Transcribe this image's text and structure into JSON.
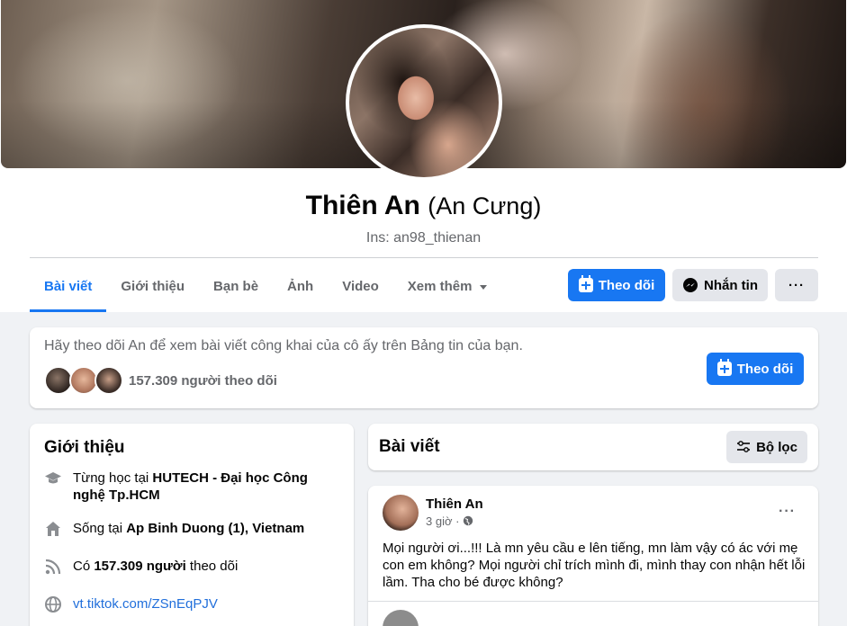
{
  "profile": {
    "name": "Thiên An",
    "alt_name": "(An Cưng)",
    "bio": "Ins: an98_thienan"
  },
  "tabs": [
    {
      "label": "Bài viết",
      "active": true
    },
    {
      "label": "Giới thiệu",
      "active": false
    },
    {
      "label": "Bạn bè",
      "active": false
    },
    {
      "label": "Ảnh",
      "active": false
    },
    {
      "label": "Video",
      "active": false
    },
    {
      "label": "Xem thêm",
      "active": false
    }
  ],
  "actions": {
    "follow": "Theo dõi",
    "message": "Nhắn tin",
    "more": "···"
  },
  "follow_prompt": {
    "text": "Hãy theo dõi An để xem bài viết công khai của cô ấy trên Bảng tin của bạn.",
    "followers": "157.309 người theo dõi",
    "button": "Theo dõi"
  },
  "intro": {
    "title": "Giới thiệu",
    "studied_prefix": "Từng học tại ",
    "studied_place": "HUTECH - Đại học Công nghệ Tp.HCM",
    "lives_prefix": "Sống tại ",
    "lives_place": "Ap Binh Duong (1), Vietnam",
    "followers_prefix": "Có ",
    "followers_count": "157.309 người",
    "followers_suffix": " theo dõi",
    "link": "vt.tiktok.com/ZSnEqPJV"
  },
  "posts_header": {
    "title": "Bài viết",
    "filter": "Bộ lọc"
  },
  "post": {
    "author": "Thiên An",
    "time": "3 giờ ·",
    "text": "Mọi người ơi...!!! Là mn yêu cầu e lên tiếng, mn làm vậy có ác với mẹ con em không? Mọi người chỉ trích mình đi, mình thay con nhận hết lỗi lầm. Tha cho bé được không?",
    "more": "···"
  },
  "colors": {
    "accent": "#1877f2",
    "background": "#f0f2f5",
    "secondary_text": "#65676b"
  }
}
